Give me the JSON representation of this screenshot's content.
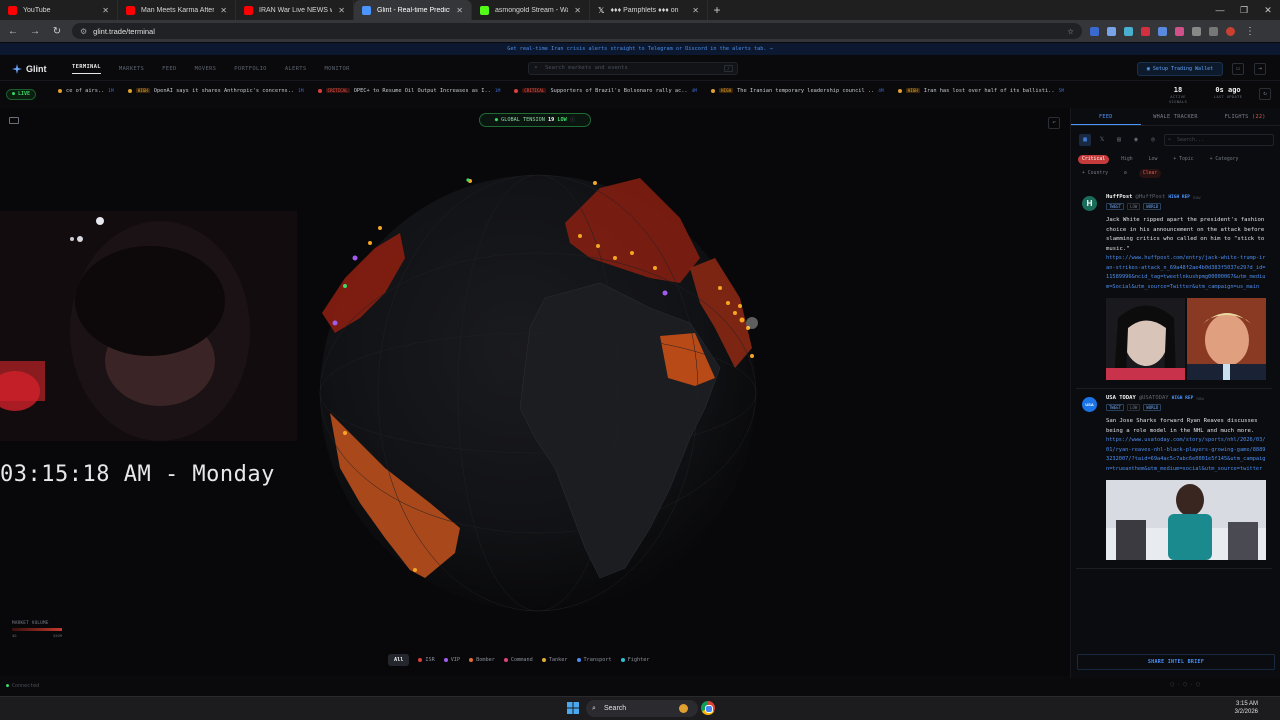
{
  "browser": {
    "tabs": [
      {
        "title": "YouTube",
        "color": "#ff0000"
      },
      {
        "title": "Man Meets Karma After Escapi",
        "color": "#ff0000"
      },
      {
        "title": "IRAN War Live NEWS with Chi",
        "color": "#ff0000"
      },
      {
        "title": "Glint - Real-time Prediction Ma",
        "color": "#4a95ff"
      },
      {
        "title": "asmongold Stream - Watch Liv",
        "color": "#53fc18"
      },
      {
        "title": "♦♦♦ Pamphlets ♦♦♦ on",
        "color": "#ffffff"
      }
    ],
    "url": "glint.trade/terminal"
  },
  "announcement": "Get real-time Iran crisis alerts straight to Telegram or Discord in the alerts tab. →",
  "app": {
    "logo": "Glint",
    "nav": [
      "TERMINAL",
      "MARKETS",
      "FEED",
      "MOVERS",
      "PORTFOLIO",
      "ALERTS",
      "MONITOR"
    ],
    "search_placeholder": "Search markets and events",
    "search_kbd": "/",
    "wallet_button": "Setup Trading Wallet"
  },
  "ticker": {
    "live_label": "LIVE",
    "items": [
      {
        "badge": "",
        "text": "ce of airs..",
        "time": "1M",
        "dot": "#e0a030"
      },
      {
        "badge": "HIGH",
        "text": "OpenAI says it shares Anthropic's concerns..",
        "time": "1M",
        "dot": "#e0a030"
      },
      {
        "badge": "CRITICAL",
        "text": "OPEC+ to Resume Oil Output Increases as I..",
        "time": "1M",
        "dot": "#d94040"
      },
      {
        "badge": "CRITICAL",
        "text": "Supporters of Brazil's Bolsonaro rally ac..",
        "time": "4M",
        "dot": "#d94040"
      },
      {
        "badge": "HIGH",
        "text": "The Iranian temporary leadership council ..",
        "time": "4M",
        "dot": "#e0a030"
      },
      {
        "badge": "HIGH",
        "text": "Iran has lost over half of its ballisti..",
        "time": "5M",
        "dot": "#e0a030"
      }
    ],
    "active_signals": "18",
    "active_signals_label": "ACTIVE SIGNALS",
    "last_update": "0s ago",
    "last_update_label": "LAST UPDATE"
  },
  "map": {
    "tension_label": "GLOBAL TENSION",
    "tension_value": "19",
    "tension_level": "LOW",
    "clock": "03:15:18 AM - Monday",
    "market_volume_label": "MARKET VOLUME",
    "market_volume_min": "$0",
    "market_volume_max": "$50M",
    "legend": [
      {
        "label": "All",
        "color": ""
      },
      {
        "label": "ISR",
        "color": "#d94040"
      },
      {
        "label": "VIP",
        "color": "#a05cf0"
      },
      {
        "label": "Bomber",
        "color": "#e07030"
      },
      {
        "label": "Command",
        "color": "#e04080"
      },
      {
        "label": "Tanker",
        "color": "#e0b030"
      },
      {
        "label": "Transport",
        "color": "#4a8ef2"
      },
      {
        "label": "Fighter",
        "color": "#30c0d0"
      }
    ],
    "status": "Connected"
  },
  "panel": {
    "tabs": [
      "FEED",
      "WHALE TRACKER",
      "FLIGHTS"
    ],
    "flights_count": "(22)",
    "search_placeholder": "Search...",
    "filters": [
      "Critical",
      "High",
      "Low",
      "+ Topic",
      "+ Category",
      "+ Country",
      "Clear"
    ],
    "posts": [
      {
        "name": "HuffPost",
        "handle": "@HuffPost",
        "rep": "HIGH REP",
        "ago": "now",
        "tags": [
          "TWEET",
          "LOW",
          "WORLD"
        ],
        "text": "Jack White ripped apart the president's fashion choice in his announcement on the attack before slamming critics who called on him to \"stick to music.\"",
        "url": "https://www.huffpost.com/entry/jack-white-trump-iran-strikes-attack_n_69a48f2ae4b0d383f5037e29?d_id=11589996&ncid_tag=tweetlnkushpmg00000067&utm_medium=Social&utm_source=Twitter&utm_campaign=us_main",
        "avatar": "H",
        "avatar_color": "#1b6b5a"
      },
      {
        "name": "USA TODAY",
        "handle": "@USATODAY",
        "rep": "HIGH REP",
        "ago": "now",
        "tags": [
          "TWEET",
          "LOW",
          "WORLD"
        ],
        "text": "San Jose Sharks forward Ryan Reaves discusses being a role model in the NHL and much more.",
        "url": "https://www.usatoday.com/story/sports/nhl/2026/03/01/ryan-reaves-nhl-black-players-growing-game/88893232007/?taid=69a4ac5c7abc6e0001e5f145&utm_campaign=trueanthem&utm_medium=social&utm_source=twitter",
        "avatar": "",
        "avatar_color": "#1a74e8"
      }
    ],
    "share_button": "SHARE INTEL BRIEF"
  },
  "taskbar": {
    "search": "Search",
    "time": "3:15 AM",
    "date": "3/2/2026"
  }
}
